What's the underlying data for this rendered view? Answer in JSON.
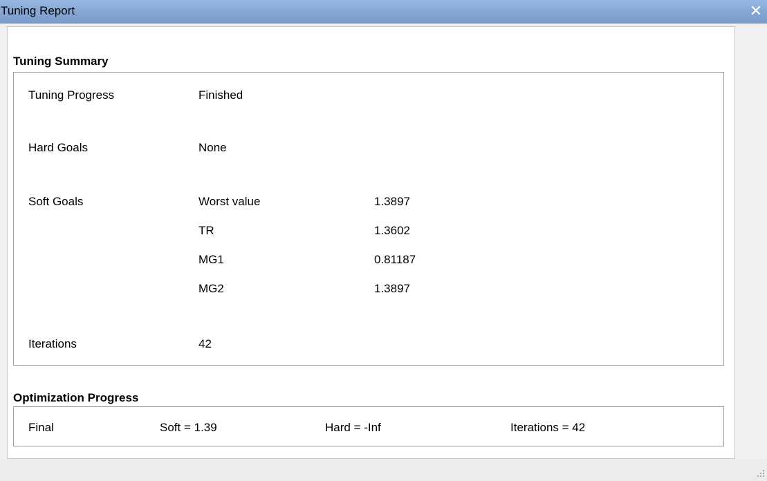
{
  "window": {
    "title": "Tuning Report",
    "close_glyph": "✕"
  },
  "tuning_summary": {
    "heading": "Tuning Summary",
    "tuning_progress": {
      "label": "Tuning Progress",
      "value": "Finished"
    },
    "hard_goals": {
      "label": "Hard Goals",
      "value": "None"
    },
    "soft_goals": {
      "label": "Soft Goals",
      "rows": [
        {
          "name": "Worst value",
          "value": "1.3897"
        },
        {
          "name": "TR",
          "value": "1.3602"
        },
        {
          "name": "MG1",
          "value": "0.81187"
        },
        {
          "name": "MG2",
          "value": "1.3897"
        }
      ]
    },
    "iterations": {
      "label": "Iterations",
      "value": "42"
    }
  },
  "optimization_progress": {
    "heading": "Optimization Progress",
    "final_label": "Final",
    "soft": "Soft = 1.39",
    "hard": "Hard = -Inf",
    "iterations": "Iterations = 42"
  }
}
